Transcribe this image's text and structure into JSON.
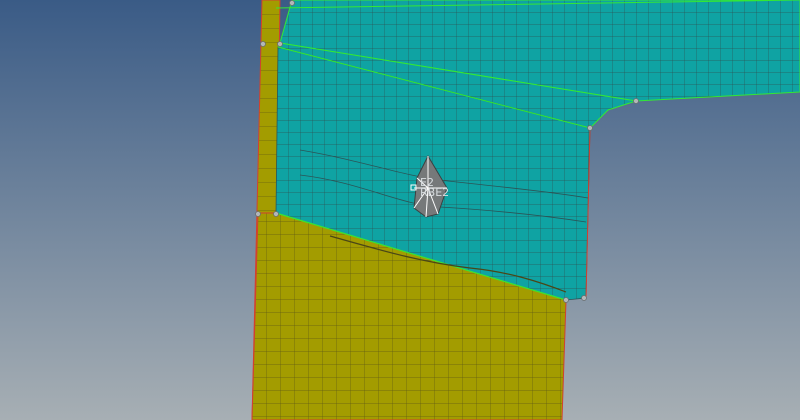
{
  "viewport": {
    "name": "graphics-area",
    "background_top": "#3a5b86",
    "background_bottom": "#a7afb4"
  },
  "parts": {
    "shell_yellow_color": "#a39c00",
    "shell_cyan_color": "#0fa3a3",
    "mesh_line_color": "#3f4a2a",
    "feature_edge_color": "#34e834",
    "free_edge_color": "#d2402f"
  },
  "rigid_element": {
    "labels": [
      "E2",
      "RBE2"
    ],
    "fill_color": "#76797a",
    "spider_color": "#ffffff"
  }
}
